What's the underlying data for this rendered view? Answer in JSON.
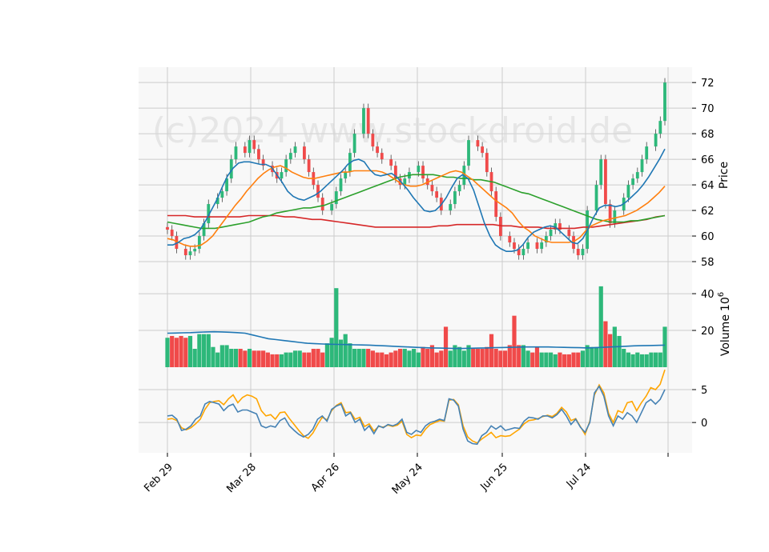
{
  "watermark": "(c)2024 www.stockdroid.de",
  "colors": {
    "up": "#2db87a",
    "down": "#f04a4a",
    "sma_short": "#1f77b4",
    "sma_mid": "#ff7f0e",
    "sma_long": "#2ca02c",
    "sma_longest": "#d62728",
    "vol_avg": "#1f77b4",
    "macd": "#4682b4",
    "signal": "#ffa500",
    "grid": "#cccccc",
    "panel_bg": "#f8f8f8"
  },
  "chart_data": [
    {
      "type": "candlestick",
      "panel": "price",
      "ylabel": "Price",
      "ylim": [
        56.5,
        73.2
      ],
      "yticks": [
        58,
        60,
        62,
        64,
        66,
        68,
        70,
        72
      ],
      "grid": true,
      "x_tick_labels": [
        "Feb 29",
        "Mar 28",
        "Apr 26",
        "May 24",
        "Jun 25",
        "Jul 24"
      ],
      "x_tick_index": [
        0,
        20,
        40,
        60,
        80,
        100
      ],
      "candles_approx_close": [
        60.5,
        60.0,
        59.0,
        58.5,
        58.8,
        59.0,
        60.0,
        61.0,
        62.5,
        63.0,
        63.5,
        64.5,
        66.0,
        67.0,
        66.5,
        67.5,
        66.8,
        66.0,
        65.5,
        65.0,
        64.5,
        65.0,
        66.0,
        66.5,
        67.0,
        66.0,
        65.0,
        64.0,
        63.0,
        62.0,
        62.5,
        63.5,
        64.5,
        65.0,
        66.5,
        68.0,
        70.0,
        68.0,
        67.0,
        66.5,
        66.0,
        65.5,
        64.5,
        64.0,
        64.5,
        65.0,
        65.5,
        64.5,
        64.0,
        63.5,
        63.0,
        62.0,
        62.5,
        63.5,
        64.0,
        65.5,
        67.5,
        67.0,
        66.5,
        65.0,
        63.5,
        61.5,
        60.0,
        59.5,
        59.0,
        58.5,
        59.0,
        59.5,
        59.0,
        59.5,
        60.0,
        60.5,
        61.0,
        60.5,
        60.0,
        59.0,
        58.5,
        59.0,
        62.0,
        64.0,
        66.0,
        62.5,
        61.0,
        62.0,
        63.0,
        64.0,
        64.5,
        65.0,
        66.0,
        67.0,
        68.0,
        69.0,
        72.0
      ],
      "series": [
        {
          "name": "",
          "values_note": "SMA short",
          "values": [
            59.3,
            59.3,
            59.5,
            59.8,
            59.9,
            60.1,
            60.5,
            61.2,
            62.0,
            62.8,
            63.8,
            64.7,
            65.3,
            65.7,
            65.8,
            65.8,
            65.7,
            65.6,
            65.6,
            65.4,
            64.8,
            64.2,
            63.5,
            63.1,
            62.9,
            62.8,
            63.0,
            63.2,
            63.5,
            63.9,
            64.3,
            64.7,
            65.1,
            65.6,
            65.9,
            66.0,
            65.8,
            65.2,
            64.8,
            64.7,
            64.8,
            64.9,
            64.6,
            64.1,
            63.6,
            63.0,
            62.5,
            62.0,
            61.9,
            62.0,
            62.4,
            63.0,
            63.8,
            64.5,
            64.8,
            64.5,
            63.6,
            62.3,
            61.0,
            60.0,
            59.3,
            59.0,
            58.8,
            58.8,
            58.9,
            59.3,
            59.9,
            60.3,
            60.5,
            60.7,
            60.8,
            60.7,
            60.3,
            59.9,
            59.5,
            59.4,
            59.8,
            60.6,
            61.5,
            62.2,
            62.4,
            62.4,
            62.3,
            62.4,
            62.7,
            63.1,
            63.5,
            64.0,
            64.6,
            65.3,
            66.0,
            66.8
          ]
        },
        {
          "name": "",
          "values_note": "SMA mid",
          "values": [
            59.8,
            59.7,
            59.5,
            59.3,
            59.2,
            59.2,
            59.3,
            59.6,
            60.0,
            60.6,
            61.2,
            61.8,
            62.4,
            62.9,
            63.5,
            64.0,
            64.5,
            64.9,
            65.2,
            65.4,
            65.5,
            65.3,
            65.0,
            64.8,
            64.6,
            64.5,
            64.5,
            64.6,
            64.7,
            64.8,
            64.9,
            65.0,
            65.0,
            65.1,
            65.1,
            65.1,
            65.1,
            65.1,
            65.0,
            64.8,
            64.5,
            64.2,
            64.0,
            63.9,
            63.9,
            64.0,
            64.2,
            64.4,
            64.6,
            64.8,
            65.0,
            65.1,
            65.0,
            64.7,
            64.4,
            64.0,
            63.6,
            63.2,
            62.8,
            62.5,
            62.2,
            61.8,
            61.2,
            60.7,
            60.4,
            60.0,
            59.8,
            59.6,
            59.5,
            59.5,
            59.5,
            59.5,
            59.6,
            59.9,
            60.4,
            60.8,
            61.0,
            61.2,
            61.3,
            61.4,
            61.5,
            61.6,
            61.8,
            62.0,
            62.3,
            62.6,
            63.0,
            63.4,
            63.9
          ]
        },
        {
          "name": "",
          "values_note": "SMA long",
          "values": [
            61.1,
            61.0,
            60.9,
            60.8,
            60.7,
            60.6,
            60.6,
            60.6,
            60.7,
            60.8,
            60.9,
            61.0,
            61.1,
            61.3,
            61.5,
            61.6,
            61.8,
            61.9,
            62.0,
            62.1,
            62.2,
            62.2,
            62.3,
            62.4,
            62.6,
            62.8,
            63.0,
            63.2,
            63.4,
            63.6,
            63.8,
            64.0,
            64.2,
            64.4,
            64.6,
            64.7,
            64.8,
            64.8,
            64.8,
            64.8,
            64.7,
            64.6,
            64.6,
            64.5,
            64.5,
            64.4,
            64.4,
            64.3,
            64.2,
            64.0,
            63.8,
            63.6,
            63.4,
            63.3,
            63.1,
            62.9,
            62.7,
            62.5,
            62.3,
            62.1,
            61.9,
            61.7,
            61.5,
            61.3,
            61.2,
            61.1,
            61.1,
            61.1,
            61.2,
            61.2,
            61.3,
            61.4,
            61.5,
            61.6
          ]
        },
        {
          "name": "",
          "values_note": "SMA longest",
          "values": [
            61.6,
            61.6,
            61.6,
            61.5,
            61.5,
            61.5,
            61.5,
            61.5,
            61.5,
            61.6,
            61.6,
            61.6,
            61.6,
            61.5,
            61.5,
            61.4,
            61.3,
            61.3,
            61.2,
            61.1,
            61.0,
            60.9,
            60.8,
            60.7,
            60.7,
            60.7,
            60.7,
            60.7,
            60.7,
            60.7,
            60.8,
            60.8,
            60.9,
            60.9,
            60.9,
            60.9,
            60.9,
            60.8,
            60.8,
            60.7,
            60.7,
            60.7,
            60.6,
            60.6,
            60.6,
            60.6,
            60.7,
            60.7,
            60.8,
            60.9,
            61.0,
            61.1,
            61.2,
            61.3,
            61.5,
            61.6
          ]
        }
      ]
    },
    {
      "type": "bar",
      "panel": "volume",
      "ylabel": "Volume",
      "ylabel_exponent": "6",
      "ylim": [
        0,
        47
      ],
      "yticks": [
        20,
        40
      ],
      "grid": true,
      "values": [
        16,
        17,
        16,
        17,
        16,
        17,
        10,
        18,
        18,
        18,
        11,
        8,
        12,
        12,
        10,
        10,
        10,
        9,
        10,
        9,
        9,
        9,
        8,
        7,
        7,
        7,
        8,
        8,
        9,
        9,
        8,
        8,
        10,
        10,
        8,
        13,
        16,
        43,
        15,
        18,
        13,
        10,
        10,
        10,
        10,
        9,
        8,
        8,
        7,
        8,
        9,
        10,
        10,
        9,
        10,
        8,
        11,
        10,
        12,
        8,
        9,
        22,
        9,
        12,
        11,
        9,
        12,
        10,
        10,
        10,
        11,
        18,
        10,
        9,
        9,
        12,
        28,
        12,
        12,
        9,
        8,
        11,
        8,
        8,
        8,
        7,
        8,
        7,
        7,
        8,
        8,
        9,
        12,
        11,
        11,
        44,
        25,
        18,
        22,
        17,
        10,
        8,
        7,
        8,
        7,
        7,
        8,
        8,
        8,
        22
      ],
      "series": [
        {
          "name": "",
          "values_note": "volume average",
          "values": [
            18.5,
            18.6,
            18.7,
            18.8,
            19.0,
            19.2,
            19.3,
            19.2,
            19.0,
            18.8,
            18.5,
            17.5,
            16.5,
            15.5,
            15.0,
            14.5,
            14.0,
            13.5,
            13.0,
            12.8,
            12.6,
            12.5,
            12.4,
            12.3,
            12.2,
            12.1,
            12.0,
            11.8,
            11.6,
            11.4,
            11.2,
            11.0,
            10.8,
            10.6,
            10.5,
            10.4,
            10.3,
            10.2,
            10.2,
            10.3,
            10.4,
            10.5,
            10.6,
            10.7,
            10.8,
            10.9,
            11.0,
            11.0,
            11.0,
            11.0,
            10.9,
            10.8,
            10.7,
            10.6,
            10.5,
            10.6,
            10.8,
            11.0,
            11.2,
            11.4,
            11.6,
            11.7,
            11.8,
            11.9,
            12.0
          ]
        }
      ]
    },
    {
      "type": "line",
      "panel": "macd",
      "ylim": [
        -4.6,
        8.4
      ],
      "yticks": [
        0,
        5
      ],
      "grid": true,
      "series": [
        {
          "name": "",
          "values_note": "MACD",
          "values": [
            1.0,
            1.1,
            0.5,
            -1.2,
            -1.0,
            -0.5,
            0.5,
            1.0,
            2.8,
            3.2,
            3.0,
            2.8,
            1.8,
            2.5,
            2.8,
            1.6,
            1.9,
            1.9,
            1.6,
            1.3,
            -0.5,
            -0.8,
            -0.5,
            -0.7,
            0.3,
            0.7,
            -0.5,
            -1.2,
            -1.8,
            -2.2,
            -1.8,
            -1.0,
            0.5,
            1.0,
            0.2,
            2.0,
            2.5,
            2.8,
            1.0,
            1.5,
            0.0,
            0.5,
            -1.2,
            -0.5,
            -1.7,
            -0.5,
            -0.8,
            -0.3,
            -0.5,
            -0.2,
            0.5,
            -1.5,
            -1.8,
            -1.2,
            -1.5,
            -0.5,
            0.0,
            0.2,
            0.5,
            0.3,
            3.6,
            3.4,
            2.5,
            -1.0,
            -2.8,
            -3.2,
            -3.3,
            -2.0,
            -1.5,
            -0.5,
            -1.0,
            -0.5,
            -1.2,
            -1.0,
            -0.8,
            -0.9,
            0.2,
            0.8,
            0.7,
            0.5,
            1.0,
            1.0,
            0.7,
            1.2,
            2.0,
            1.0,
            -0.3,
            0.5,
            -0.7,
            -1.5,
            0.0,
            4.5,
            5.5,
            4.0,
            1.0,
            -0.5,
            1.0,
            0.5,
            1.5,
            1.0,
            0.0,
            1.5,
            3.0,
            3.5,
            2.8,
            3.5,
            5.0
          ]
        },
        {
          "name": "",
          "values_note": "signal",
          "values": [
            0.5,
            0.6,
            0.3,
            -0.8,
            -1.1,
            -0.8,
            -0.2,
            0.5,
            2.0,
            3.0,
            3.2,
            3.3,
            2.7,
            3.6,
            4.2,
            3.0,
            3.8,
            4.2,
            4.0,
            3.6,
            1.8,
            1.0,
            1.2,
            0.5,
            1.5,
            1.6,
            0.6,
            -0.3,
            -1.2,
            -2.0,
            -2.4,
            -1.6,
            -0.3,
            0.8,
            0.4,
            1.8,
            2.6,
            3.0,
            1.5,
            1.6,
            0.5,
            0.8,
            -0.6,
            -0.2,
            -1.3,
            -0.6,
            -0.7,
            -0.4,
            -0.6,
            -0.4,
            0.2,
            -1.8,
            -2.3,
            -1.9,
            -2.0,
            -1.0,
            -0.3,
            0.0,
            0.3,
            0.2,
            3.4,
            3.5,
            2.7,
            -0.5,
            -2.2,
            -2.8,
            -3.1,
            -2.5,
            -2.0,
            -1.5,
            -2.3,
            -2.0,
            -2.1,
            -2.0,
            -1.5,
            -1.0,
            -0.2,
            0.3,
            0.4,
            0.6,
            0.9,
            1.1,
            0.9,
            1.4,
            2.3,
            1.6,
            0.3,
            0.6,
            -0.6,
            -1.8,
            0.2,
            4.2,
            5.7,
            4.5,
            1.4,
            0.0,
            1.8,
            1.5,
            3.0,
            3.2,
            1.8,
            3.0,
            4.0,
            5.3,
            5.0,
            5.8,
            8.0
          ]
        }
      ]
    }
  ]
}
